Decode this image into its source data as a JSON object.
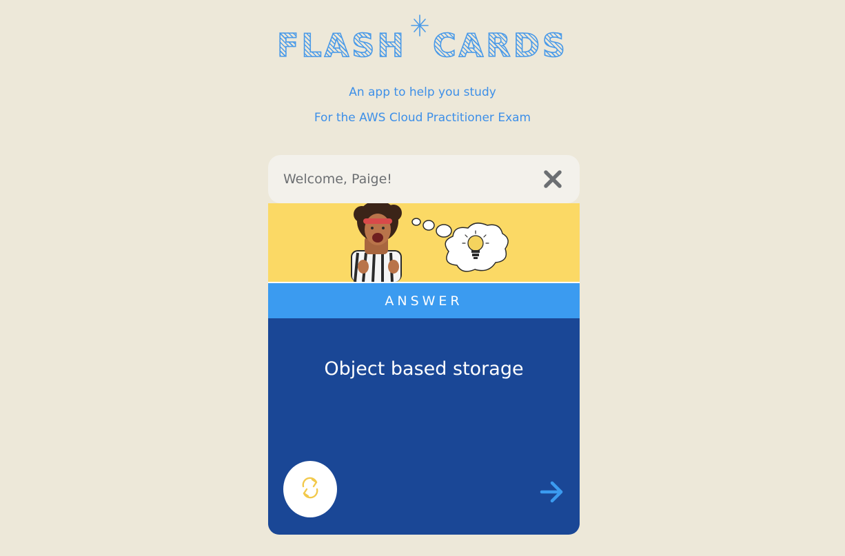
{
  "logo": {
    "word1": "FLASH",
    "word2": "CARDS",
    "star_icon": "sparkle-icon",
    "color": "#4a9ae8"
  },
  "subtitle": {
    "line1": "An app to help you study",
    "line2": "For the AWS Cloud Practitioner Exam"
  },
  "welcome": {
    "text": "Welcome, Paige!",
    "close_icon": "close-icon"
  },
  "card": {
    "banner_image": "woman-lightbulb-thought-illustration",
    "side_label": "ANSWER",
    "content": "Object based storage",
    "flip_icon": "flip-icon",
    "next_icon": "arrow-right-icon"
  },
  "colors": {
    "background": "#ede8d9",
    "accent": "#3b9bf0",
    "card": "#1a4796",
    "banner": "#fbd965",
    "flip_icon": "#f2c94c"
  }
}
